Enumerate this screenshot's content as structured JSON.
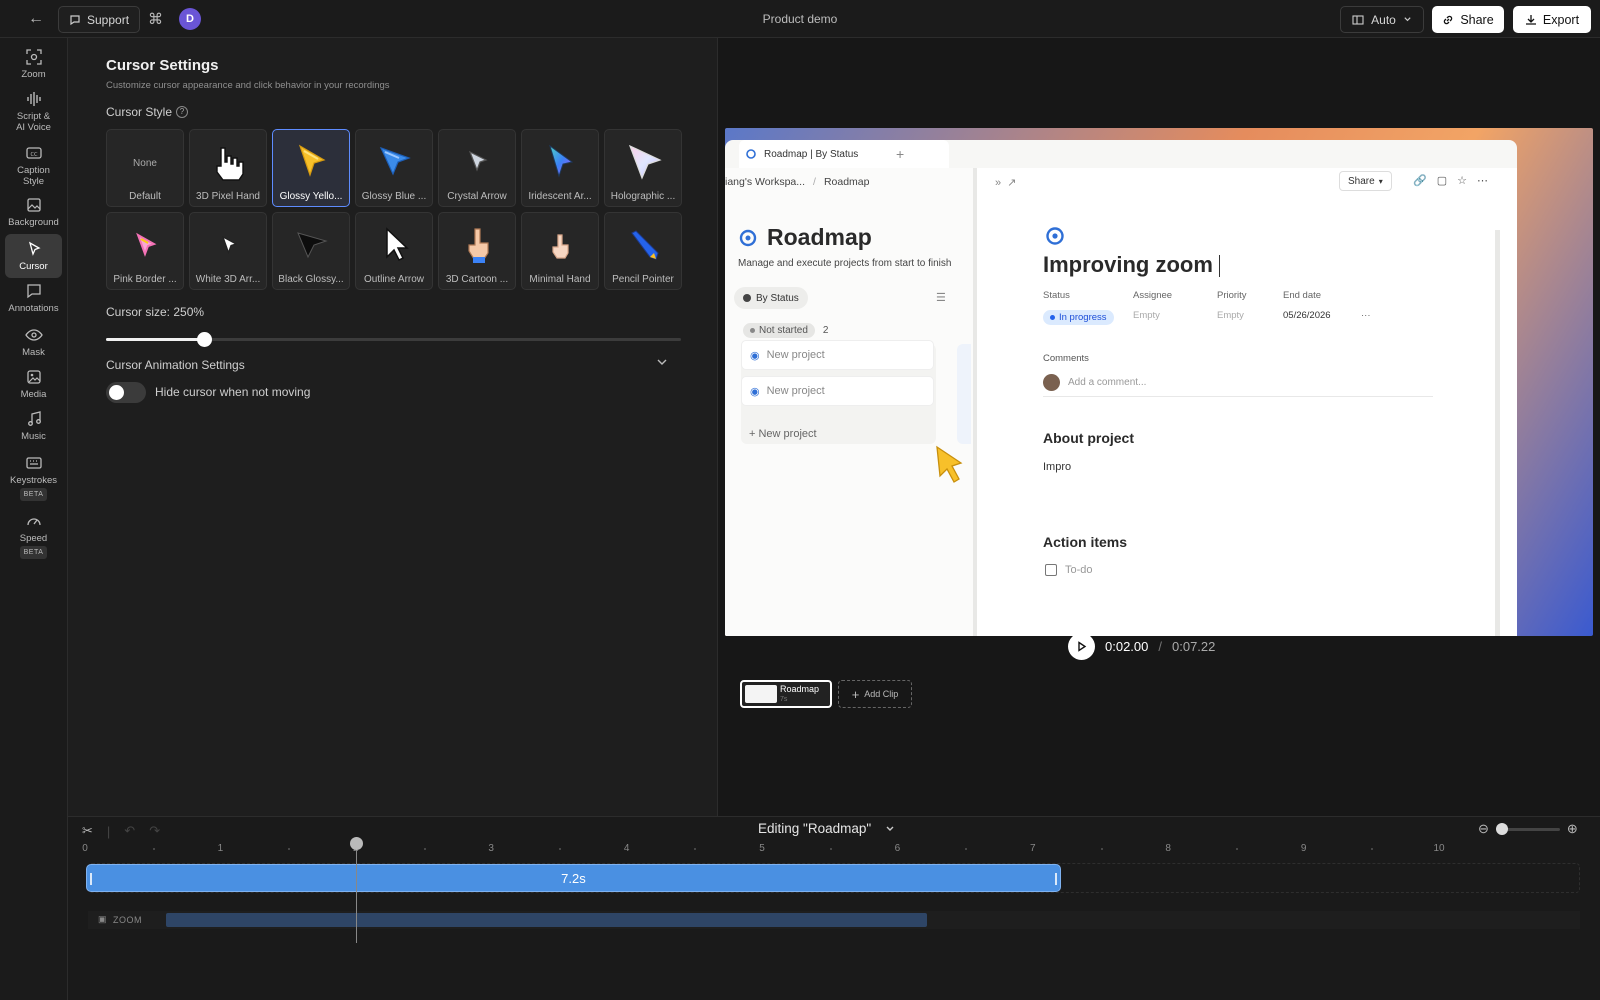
{
  "topbar": {
    "support_label": "Support",
    "cmd_symbol": "⌘",
    "avatar_letter": "D",
    "project_title": "Product demo",
    "layout_label": "Auto",
    "share_label": "Share",
    "export_label": "Export"
  },
  "rail": {
    "items": [
      {
        "label": "Zoom",
        "icon": "zoom-icon"
      },
      {
        "label": "Script &",
        "label2": "AI Voice",
        "icon": "waveform-icon"
      },
      {
        "label": "Caption",
        "label2": "Style",
        "icon": "caption-icon"
      },
      {
        "label": "Background",
        "icon": "image-icon"
      },
      {
        "label": "Cursor",
        "icon": "cursor-icon",
        "active": true
      },
      {
        "label": "Annotations",
        "icon": "comment-icon"
      },
      {
        "label": "Mask",
        "icon": "eye-icon"
      },
      {
        "label": "Media",
        "icon": "media-icon"
      },
      {
        "label": "Music",
        "icon": "music-icon"
      },
      {
        "label": "Keystrokes",
        "badge": "BETA",
        "icon": "keyboard-icon"
      },
      {
        "label": "Speed",
        "badge": "BETA",
        "icon": "speed-icon"
      }
    ]
  },
  "settings": {
    "title": "Cursor Settings",
    "subtitle": "Customize cursor appearance and click behavior in your recordings",
    "style_label": "Cursor Style",
    "help_glyph": "?",
    "cursors": [
      {
        "label": "Default",
        "none_text": "None",
        "art": "none"
      },
      {
        "label": "3D Pixel Hand",
        "art": "pixel-hand"
      },
      {
        "label": "Glossy Yello...",
        "art": "yellow-arrow",
        "selected": true
      },
      {
        "label": "Glossy Blue ...",
        "art": "blue-arrow"
      },
      {
        "label": "Crystal Arrow",
        "art": "crystal-arrow"
      },
      {
        "label": "Iridescent Ar...",
        "art": "iridescent-arrow"
      },
      {
        "label": "Holographic ...",
        "art": "holo-arrow"
      },
      {
        "label": "Pink Border ...",
        "art": "pink-arrow"
      },
      {
        "label": "White 3D Arr...",
        "art": "white-arrow"
      },
      {
        "label": "Black Glossy...",
        "art": "black-arrow"
      },
      {
        "label": "Outline Arrow",
        "art": "outline-arrow"
      },
      {
        "label": "3D Cartoon ...",
        "art": "cartoon-hand"
      },
      {
        "label": "Minimal Hand",
        "art": "minimal-hand"
      },
      {
        "label": "Pencil Pointer",
        "art": "pencil"
      }
    ],
    "size_label": "Cursor size: 250%",
    "size_fraction": 0.17,
    "animation_label": "Cursor Animation Settings",
    "hide_cursor_label": "Hide cursor when not moving",
    "hide_cursor_on": false
  },
  "preview": {
    "tab_title": "Roadmap | By Status",
    "crumb_workspace": "iang's Workspa...",
    "crumb_page": "Roadmap",
    "board_title": "Roadmap",
    "board_subtitle": "Manage and execute projects from start to finish",
    "view_label": "By Status",
    "group_label": "Not started",
    "group_count": "2",
    "new_project": "New project",
    "share_label": "Share",
    "page_title": "Improving zoom",
    "props": [
      {
        "label": "Status",
        "value": "In progress"
      },
      {
        "label": "Assignee",
        "value": "Empty"
      },
      {
        "label": "Priority",
        "value": "Empty"
      },
      {
        "label": "End date",
        "value": "05/26/2026"
      }
    ],
    "more_glyph": "···",
    "comments_label": "Comments",
    "comment_placeholder": "Add a comment...",
    "about_title": "About project",
    "about_text": "Impro",
    "actions_title": "Action items",
    "todo_label": "To-do"
  },
  "player": {
    "current_time": "0:02.00",
    "separator": "/",
    "total_time": "0:07.22"
  },
  "clips": {
    "clip_label": "Roadmap",
    "clip_duration": "7s",
    "add_clip_label": "Add Clip"
  },
  "timeline": {
    "editing_label": "Editing \"Roadmap\"",
    "ticks": [
      "0",
      "1",
      "2",
      "3",
      "4",
      "5",
      "6",
      "7",
      "8",
      "9",
      "10"
    ],
    "clip_duration_label": "7.2s",
    "clip_length_seconds": 7.2,
    "playhead_seconds": 2.0,
    "zoom_row_label": "ZOOM",
    "zoom_segment_start_s": 0.6,
    "zoom_segment_end_s": 6.22
  }
}
